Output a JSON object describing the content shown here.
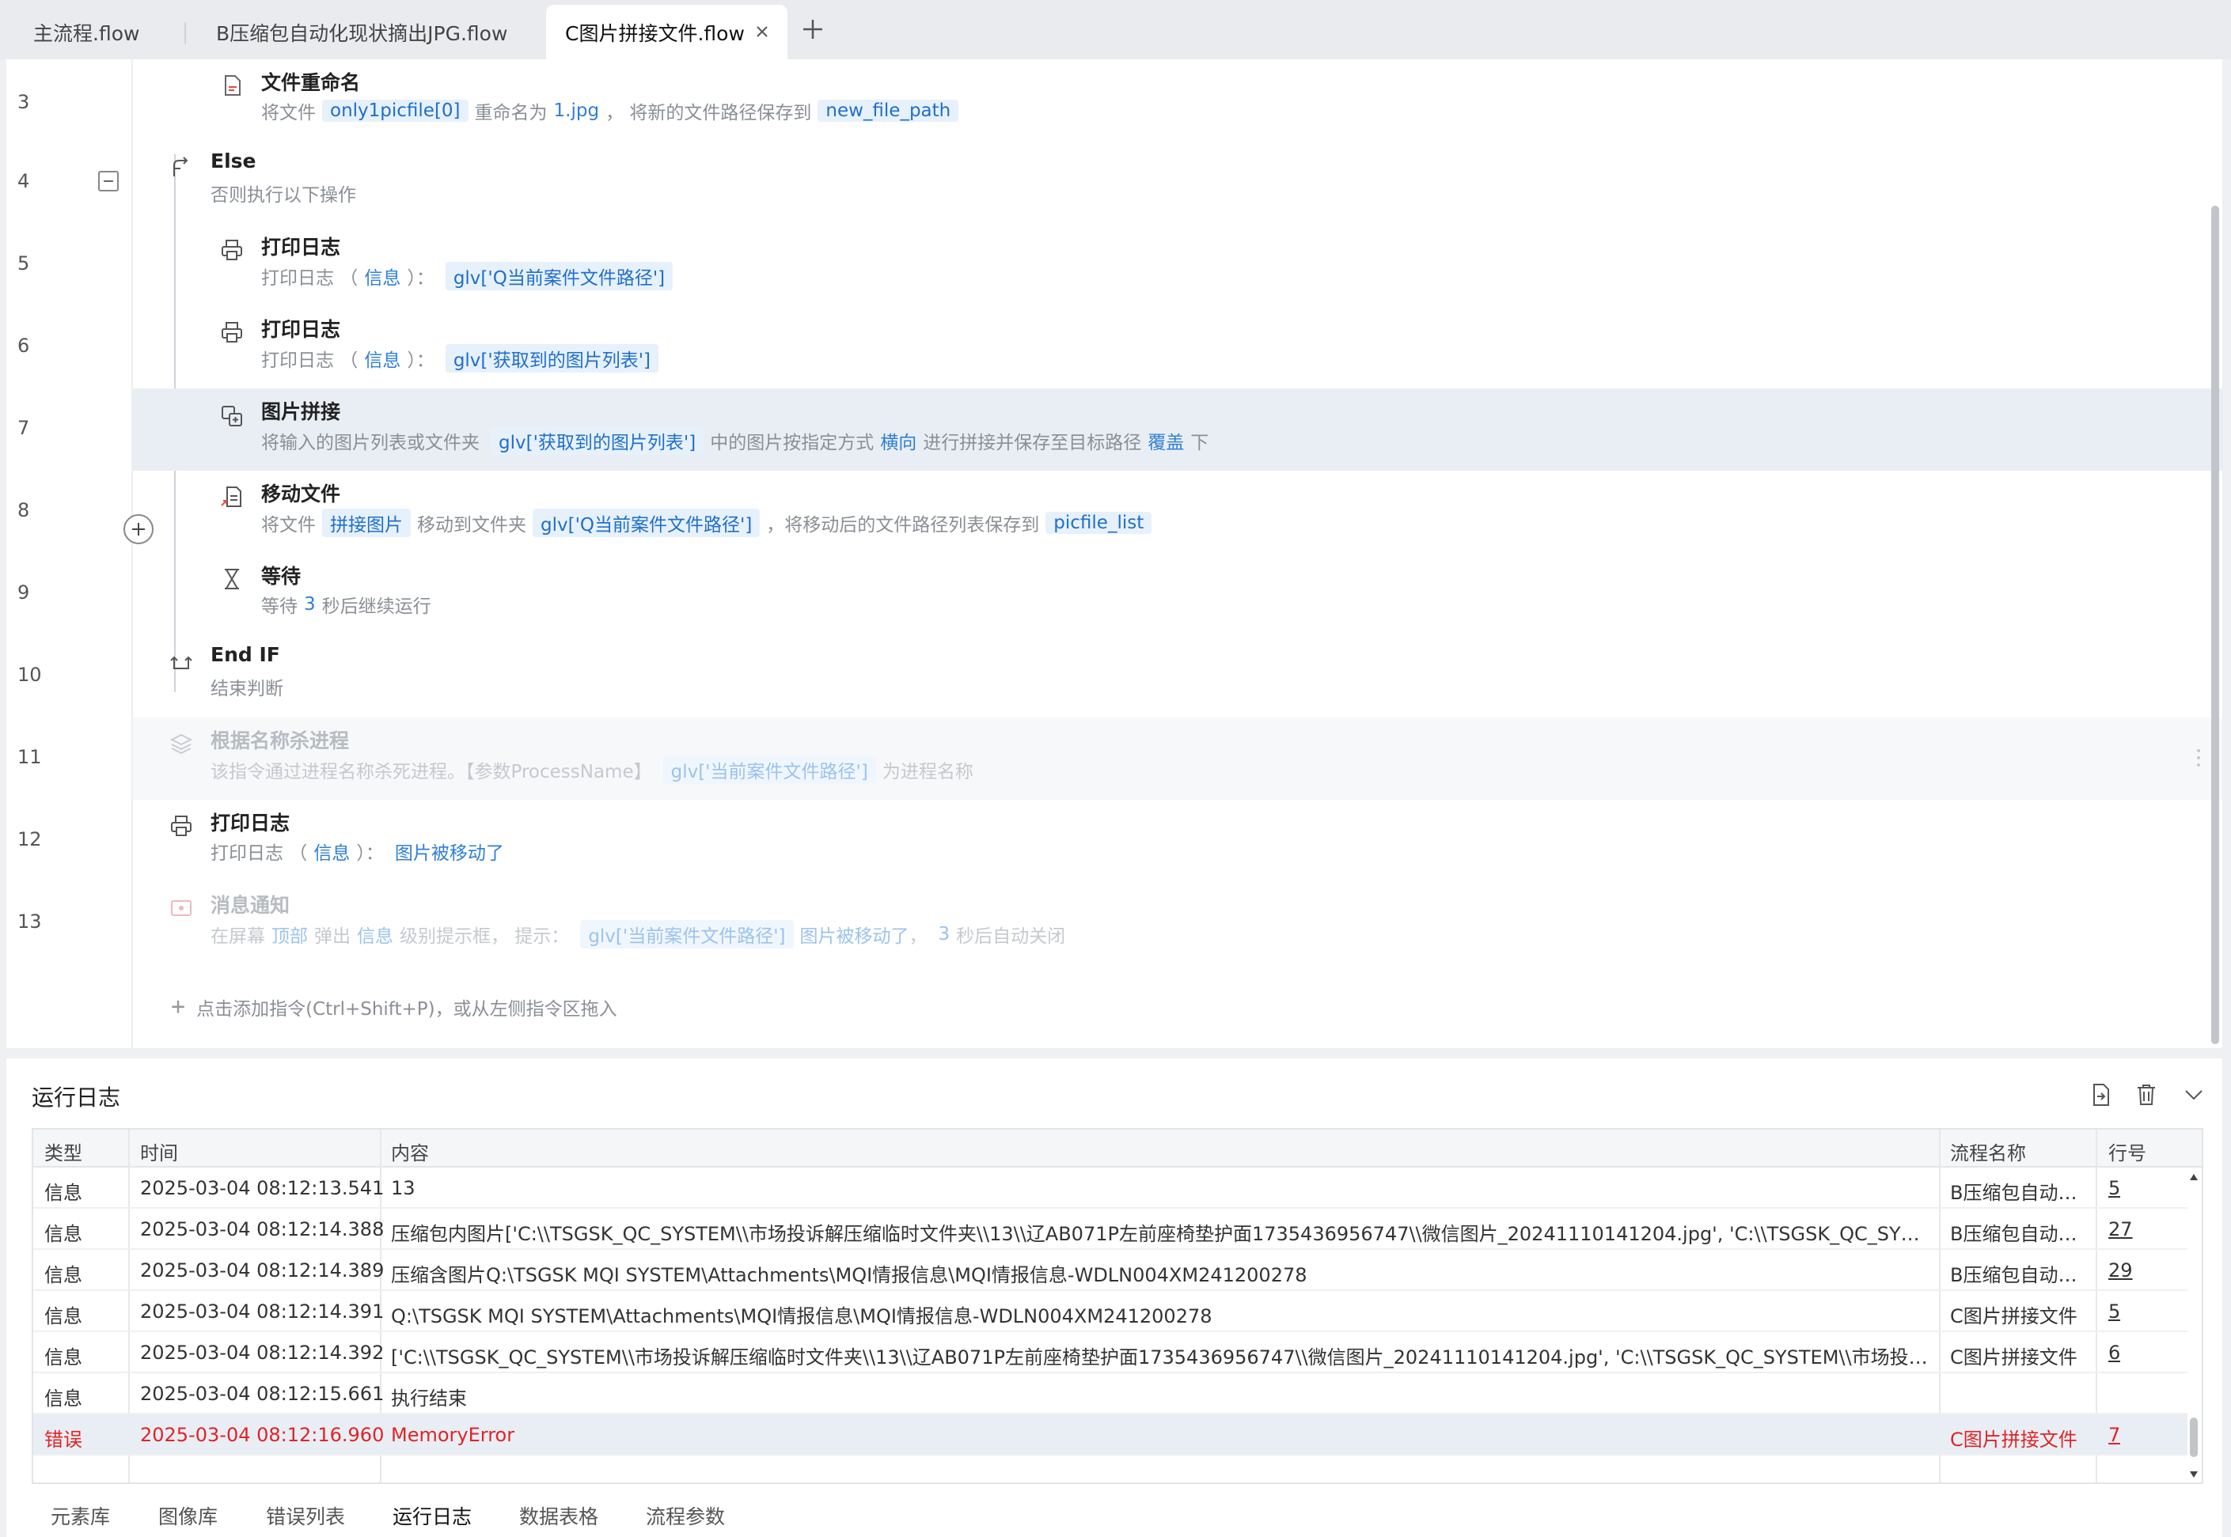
{
  "tabs": [
    {
      "label": "主流程.flow"
    },
    {
      "label": "B压缩包自动化现状摘出JPG.flow"
    },
    {
      "label": "C图片拼接文件.flow"
    }
  ],
  "editor": {
    "line_numbers": [
      "3",
      "4",
      "5",
      "6",
      "7",
      "8",
      "9",
      "10",
      "11",
      "12",
      "13"
    ],
    "steps": {
      "rename": {
        "title": "文件重命名",
        "p1": "将文件",
        "file": "only1picfile[0]",
        "p2": "重命名为",
        "name": "1.jpg",
        "p3": "，  将新的文件路径保存到",
        "var": "new_file_path"
      },
      "else": {
        "title": "Else",
        "desc": "否则执行以下操作"
      },
      "log1": {
        "title": "打印日志",
        "p1": "打印日志 （",
        "level": "信息",
        "p2": "）：",
        "msg": "glv['Q当前案件文件路径']"
      },
      "log2": {
        "title": "打印日志",
        "p1": "打印日志 （",
        "level": "信息",
        "p2": "）：",
        "msg": "glv['获取到的图片列表']"
      },
      "stitch": {
        "title": "图片拼接",
        "p1": "将输入的图片列表或文件夹",
        "input": "glv['获取到的图片列表']",
        "p2": "中的图片按指定方式",
        "mode": "横向",
        "p3": "进行拼接并保存至目标路径",
        "overwrite": "覆盖",
        "p4": "下"
      },
      "move": {
        "title": "移动文件",
        "p1": "将文件",
        "file": "拼接图片",
        "p2": "移动到文件夹",
        "folder": "glv['Q当前案件文件路径']",
        "p3": "，将移动后的文件路径列表保存到",
        "var": "picfile_list"
      },
      "wait": {
        "title": "等待",
        "p1": "等待",
        "sec": "3",
        "p2": "秒后继续运行"
      },
      "endif": {
        "title": "End IF",
        "desc": "结束判断"
      },
      "kill": {
        "title": "根据名称杀进程",
        "p1": "该指令通过进程名称杀死进程。【参数ProcessName】",
        "var": "glv['当前案件文件路径']",
        "p2": "为进程名称"
      },
      "log3": {
        "title": "打印日志",
        "p1": "打印日志 （",
        "level": "信息",
        "p2": "）：",
        "msg": "图片被移动了"
      },
      "notify": {
        "title": "消息通知",
        "p1": "在屏幕",
        "pos": "顶部",
        "p2": "弹出",
        "level": "信息",
        "p3": "级别提示框，  提示：",
        "var": "glv['当前案件文件路径']",
        "msg": "图片被移动了",
        "p4": "，",
        "sec": "3",
        "p5": "秒后自动关闭"
      }
    },
    "add_hint": "点击添加指令(Ctrl+Shift+P)，或从左侧指令区拖入"
  },
  "log": {
    "title": "运行日志",
    "columns": [
      "类型",
      "时间",
      "内容",
      "流程名称",
      "行号"
    ],
    "rows": [
      {
        "type": "信息",
        "time": "2025-03-04 08:12:13.541",
        "content": "13",
        "flow": "B压缩包自动化...",
        "line": "5"
      },
      {
        "type": "信息",
        "time": "2025-03-04 08:12:14.388",
        "content": "压缩包内图片['C:\\\\TSGSK_QC_SYSTEM\\\\市场投诉解压缩临时文件夹\\\\13\\\\辽AB071P左前座椅垫护面1735436956747\\\\微信图片_20241110141204.jpg', 'C:\\\\TSGSK_QC_SYSTEM...",
        "flow": "B压缩包自动化...",
        "line": "27"
      },
      {
        "type": "信息",
        "time": "2025-03-04 08:12:14.389",
        "content": "压缩含图片Q:\\TSGSK MQI SYSTEM\\Attachments\\MQI情报信息\\MQI情报信息-WDLN004XM241200278",
        "flow": "B压缩包自动化...",
        "line": "29"
      },
      {
        "type": "信息",
        "time": "2025-03-04 08:12:14.391",
        "content": "Q:\\TSGSK MQI SYSTEM\\Attachments\\MQI情报信息\\MQI情报信息-WDLN004XM241200278",
        "flow": "C图片拼接文件",
        "line": "5"
      },
      {
        "type": "信息",
        "time": "2025-03-04 08:12:14.392",
        "content": "['C:\\\\TSGSK_QC_SYSTEM\\\\市场投诉解压缩临时文件夹\\\\13\\\\辽AB071P左前座椅垫护面1735436956747\\\\微信图片_20241110141204.jpg', 'C:\\\\TSGSK_QC_SYSTEM\\\\市场投诉解...",
        "flow": "C图片拼接文件",
        "line": "6"
      },
      {
        "type": "信息",
        "time": "2025-03-04 08:12:15.661",
        "content": "执行结束",
        "flow": "",
        "line": ""
      },
      {
        "type": "错误",
        "time": "2025-03-04 08:12:16.960",
        "content": "MemoryError",
        "flow": "C图片拼接文件",
        "line": "7"
      }
    ]
  },
  "bottom_tabs": [
    "元素库",
    "图像库",
    "错误列表",
    "运行日志",
    "数据表格",
    "流程参数"
  ],
  "colors": {
    "accent": "#2f7fd6",
    "error": "#e02424",
    "highlight_row": "#e9eef5"
  }
}
